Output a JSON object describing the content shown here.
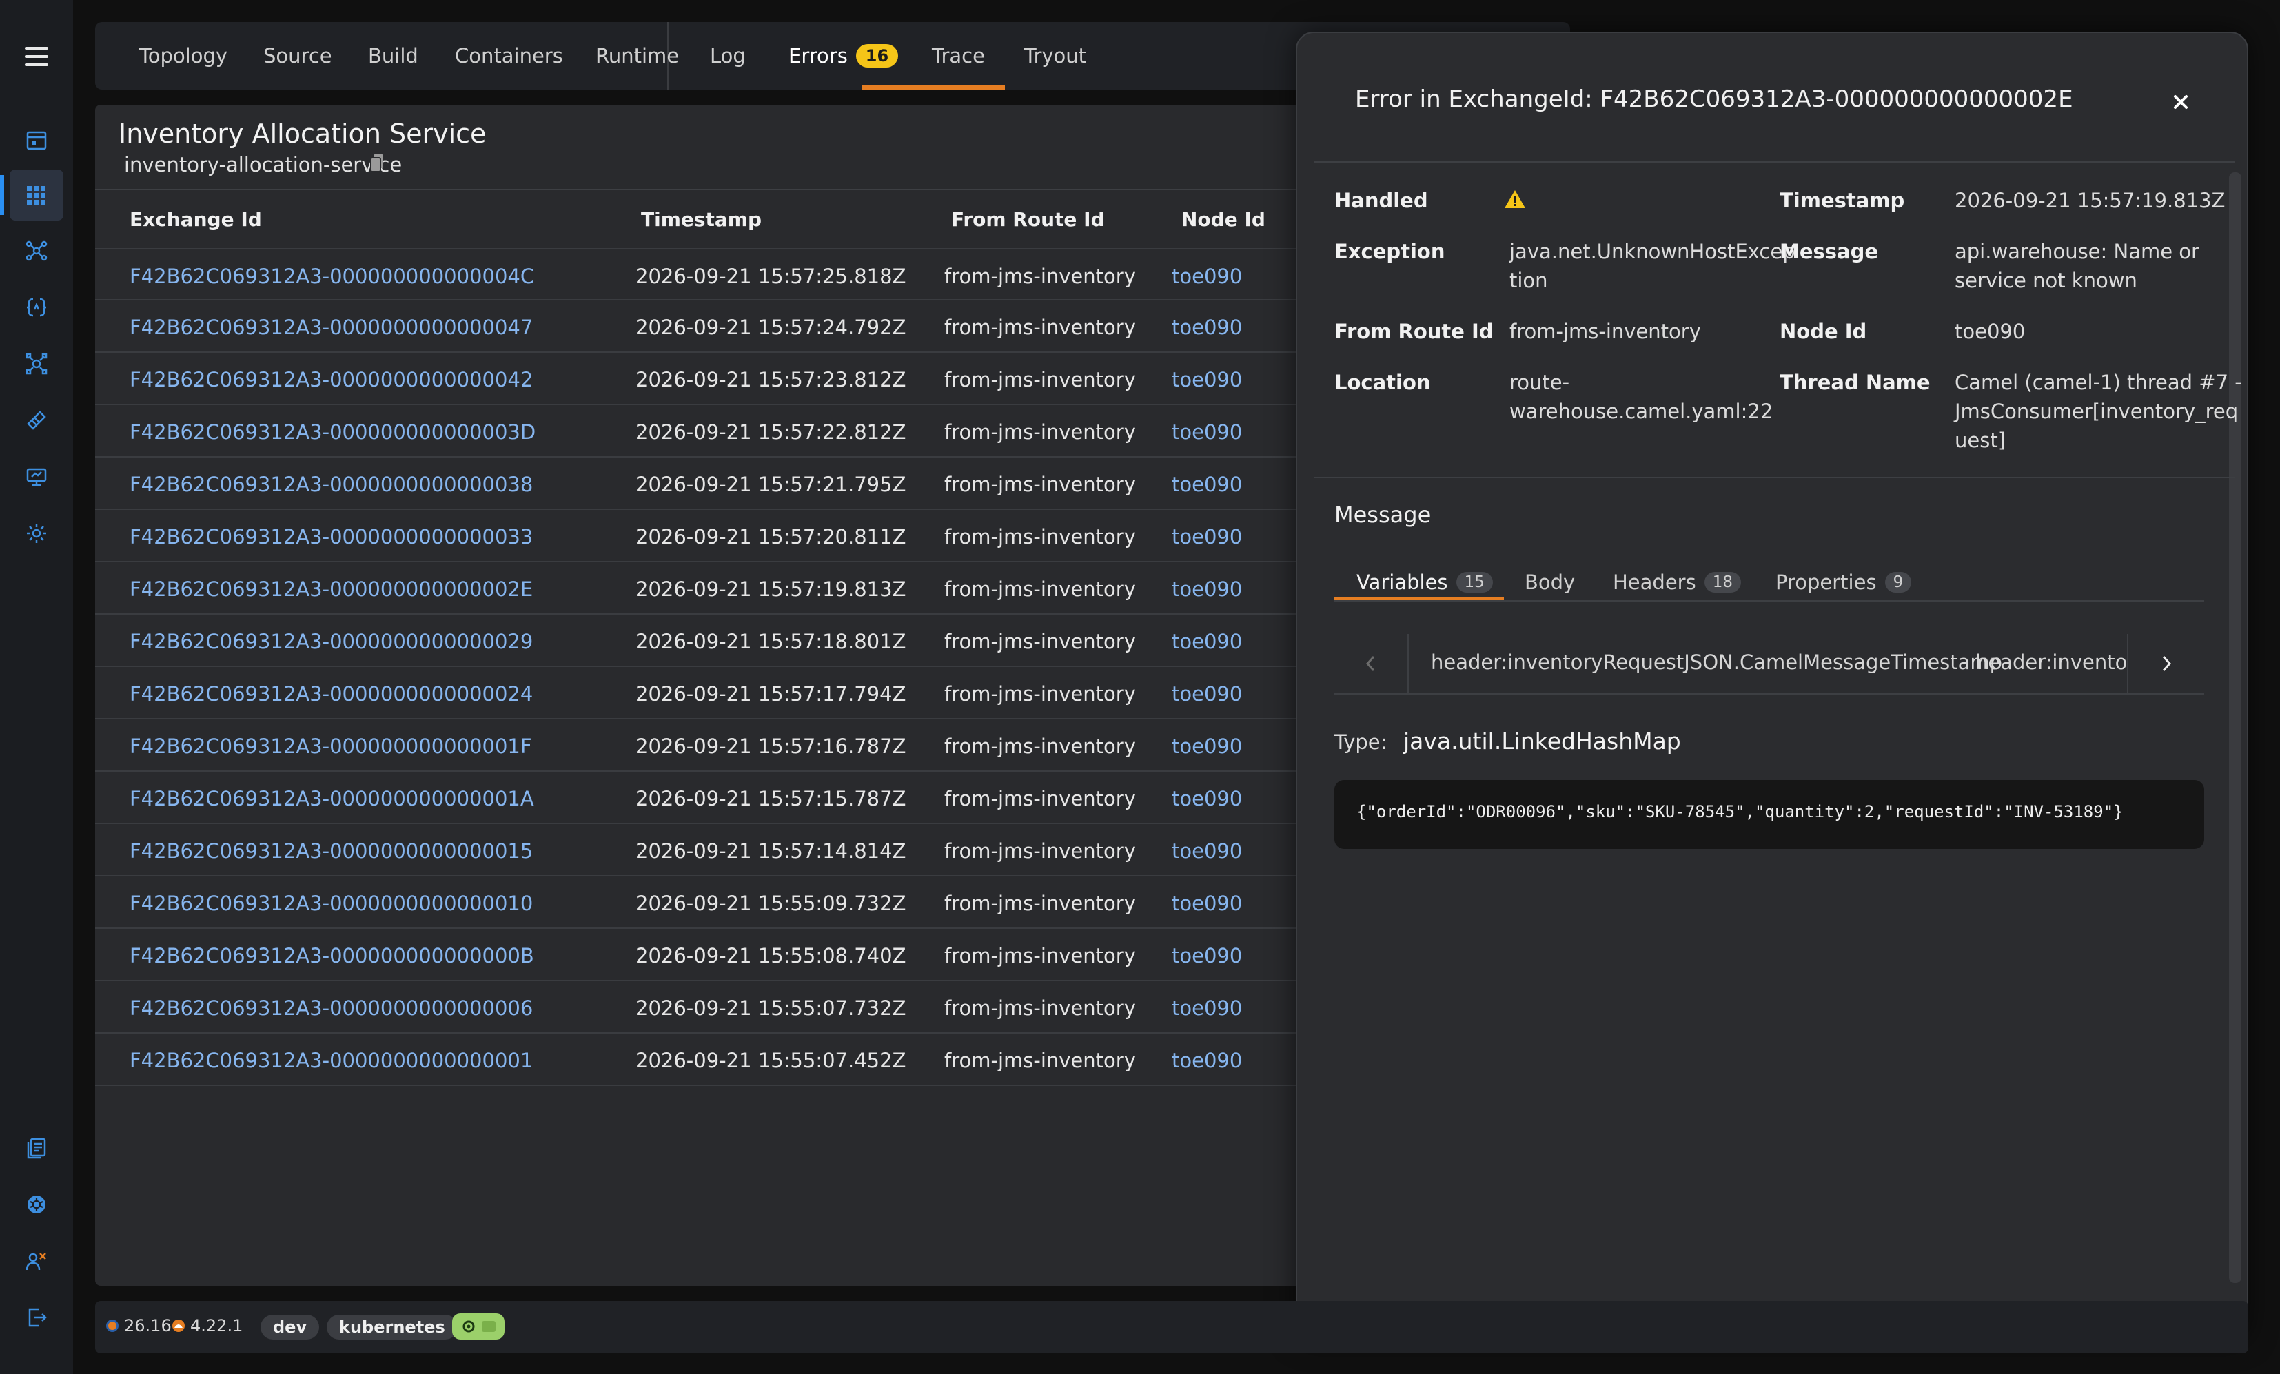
{
  "tabs": [
    {
      "label": "Topology"
    },
    {
      "label": "Source"
    },
    {
      "label": "Build"
    },
    {
      "label": "Containers"
    },
    {
      "label": "Runtime"
    },
    {
      "label": "Log"
    },
    {
      "label": "Errors",
      "badge": "16"
    },
    {
      "label": "Trace"
    },
    {
      "label": "Tryout"
    }
  ],
  "active_tab": "Errors",
  "service": {
    "title": "Inventory Allocation Service",
    "id": "inventory-allocation-service"
  },
  "table": {
    "headers": [
      "Exchange Id",
      "Timestamp",
      "From Route Id",
      "Node Id"
    ],
    "rows": [
      [
        "F42B62C069312A3-000000000000004C",
        "2026-09-21 15:57:25.818Z",
        "from-jms-inventory",
        "toe090"
      ],
      [
        "F42B62C069312A3-0000000000000047",
        "2026-09-21 15:57:24.792Z",
        "from-jms-inventory",
        "toe090"
      ],
      [
        "F42B62C069312A3-0000000000000042",
        "2026-09-21 15:57:23.812Z",
        "from-jms-inventory",
        "toe090"
      ],
      [
        "F42B62C069312A3-000000000000003D",
        "2026-09-21 15:57:22.812Z",
        "from-jms-inventory",
        "toe090"
      ],
      [
        "F42B62C069312A3-0000000000000038",
        "2026-09-21 15:57:21.795Z",
        "from-jms-inventory",
        "toe090"
      ],
      [
        "F42B62C069312A3-0000000000000033",
        "2026-09-21 15:57:20.811Z",
        "from-jms-inventory",
        "toe090"
      ],
      [
        "F42B62C069312A3-000000000000002E",
        "2026-09-21 15:57:19.813Z",
        "from-jms-inventory",
        "toe090"
      ],
      [
        "F42B62C069312A3-0000000000000029",
        "2026-09-21 15:57:18.801Z",
        "from-jms-inventory",
        "toe090"
      ],
      [
        "F42B62C069312A3-0000000000000024",
        "2026-09-21 15:57:17.794Z",
        "from-jms-inventory",
        "toe090"
      ],
      [
        "F42B62C069312A3-000000000000001F",
        "2026-09-21 15:57:16.787Z",
        "from-jms-inventory",
        "toe090"
      ],
      [
        "F42B62C069312A3-000000000000001A",
        "2026-09-21 15:57:15.787Z",
        "from-jms-inventory",
        "toe090"
      ],
      [
        "F42B62C069312A3-0000000000000015",
        "2026-09-21 15:57:14.814Z",
        "from-jms-inventory",
        "toe090"
      ],
      [
        "F42B62C069312A3-0000000000000010",
        "2026-09-21 15:55:09.732Z",
        "from-jms-inventory",
        "toe090"
      ],
      [
        "F42B62C069312A3-000000000000000B",
        "2026-09-21 15:55:08.740Z",
        "from-jms-inventory",
        "toe090"
      ],
      [
        "F42B62C069312A3-0000000000000006",
        "2026-09-21 15:55:07.732Z",
        "from-jms-inventory",
        "toe090"
      ],
      [
        "F42B62C069312A3-0000000000000001",
        "2026-09-21 15:55:07.452Z",
        "from-jms-inventory",
        "toe090"
      ]
    ]
  },
  "drawer": {
    "title": "Error in ExchangeId: F42B62C069312A3-000000000000002E",
    "fields": {
      "handled_label": "Handled",
      "timestamp_label": "Timestamp",
      "timestamp_value": "2026-09-21 15:57:19.813Z",
      "exception_label": "Exception",
      "exception_value_1": "java.net.UnknownHostExcep",
      "exception_value_2": "tion",
      "message_label": "Message",
      "message_value_1": "api.warehouse: Name or",
      "message_value_2": "service not known",
      "from_route_label": "From Route Id",
      "from_route_value": "from-jms-inventory",
      "node_label": "Node Id",
      "node_value": "toe090",
      "location_label": "Location",
      "location_value_1": "route-",
      "location_value_2": "warehouse.camel.yaml:22",
      "thread_label": "Thread Name",
      "thread_value_1": "Camel (camel-1) thread #7 -",
      "thread_value_2": "JmsConsumer[inventory_req",
      "thread_value_3": "uest]"
    },
    "message_heading": "Message",
    "sub_tabs": [
      {
        "label": "Variables",
        "count": "15"
      },
      {
        "label": "Body"
      },
      {
        "label": "Headers",
        "count": "18"
      },
      {
        "label": "Properties",
        "count": "9"
      }
    ],
    "variables": [
      "header:inventoryRequestJSON.CamelMessageTimestamp",
      "header:inventoryR"
    ],
    "type_label": "Type:",
    "type_value": "java.util.LinkedHashMap",
    "code": "{\"orderId\":\"ODR00096\",\"sku\":\"SKU-78545\",\"quantity\":2,\"requestId\":\"INV-53189\"}"
  },
  "statusbar": {
    "version_a": "26.16",
    "version_b": "4.22.1",
    "env": "dev",
    "platform": "kubernetes"
  },
  "colors": {
    "accent": "#e67e22",
    "link": "#86b5ee",
    "badge": "#f5c518",
    "warning": "#f5c518"
  }
}
